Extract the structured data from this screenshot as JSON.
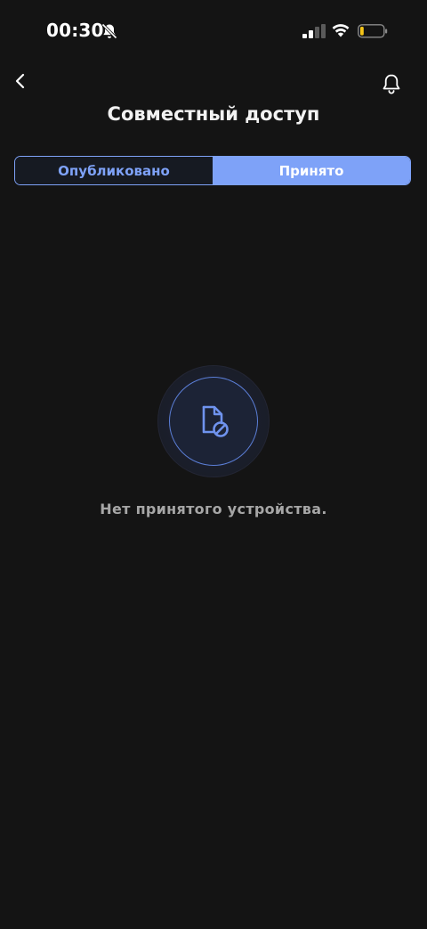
{
  "status_bar": {
    "time": "00:30",
    "icons": [
      "bell-off-icon",
      "signal-icon",
      "wifi-icon",
      "battery-icon"
    ],
    "battery_level": 0.15
  },
  "header": {
    "title": "Совместный доступ",
    "back_icon": "chevron-left-icon",
    "notification_icon": "bell-icon"
  },
  "tabs": [
    {
      "label": "Опубликовано",
      "active": false
    },
    {
      "label": "Принято",
      "active": true
    }
  ],
  "empty_state": {
    "icon": "file-blocked-icon",
    "message": "Нет принятого устройства."
  },
  "colors": {
    "background": "#141414",
    "accent": "#7ea2f8",
    "battery_low": "#f5c518",
    "muted_text": "#a6a6a6"
  }
}
